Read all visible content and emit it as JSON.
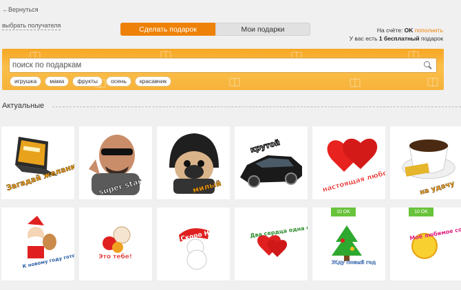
{
  "nav": {
    "back_label": "←Вернуться",
    "recipient_label": "выбрать получателя"
  },
  "tabs": [
    {
      "label": "Сделать подарок",
      "active": true
    },
    {
      "label": "Мои подарки",
      "active": false
    }
  ],
  "account": {
    "balance_prefix": "На счёте:",
    "balance_value": "OK",
    "topup_label": "пополнить",
    "free_gift_prefix": "У вас есть",
    "free_gift_strong": "1 бесплатный",
    "free_gift_suffix": "подарок"
  },
  "search": {
    "placeholder": "поиск по подаркам",
    "tags": [
      "игрушка",
      "мама",
      "фрукты",
      "осень",
      "красавчик"
    ]
  },
  "section": {
    "title": "Актуальные"
  },
  "gifts": [
    {
      "id": "laptop",
      "caption": "Загадай желание",
      "badge": ""
    },
    {
      "id": "man",
      "caption": "super star",
      "badge": ""
    },
    {
      "id": "pug",
      "caption": "милый",
      "badge": ""
    },
    {
      "id": "car",
      "caption": "крутой",
      "badge": ""
    },
    {
      "id": "hearts",
      "caption": "настоящая любовь",
      "badge": ""
    },
    {
      "id": "coffee",
      "caption": "на удачу",
      "badge": ""
    },
    {
      "id": "santa",
      "caption": "К новому году готов",
      "badge": ""
    },
    {
      "id": "hen",
      "caption": "Это тебе!",
      "badge": ""
    },
    {
      "id": "snowman",
      "caption": "Скоро Новый год",
      "badge": ""
    },
    {
      "id": "heart-text",
      "caption": "Два сердца одна судьба",
      "badge": ""
    },
    {
      "id": "tree",
      "caption": "Жду Новый год",
      "badge": "10 OK"
    },
    {
      "id": "sun",
      "caption": "Моё любимое солнышко",
      "badge": "10 OK"
    }
  ],
  "colors": {
    "accent": "#ee8208",
    "banner": "#f7a623",
    "badge": "#69c33b"
  }
}
